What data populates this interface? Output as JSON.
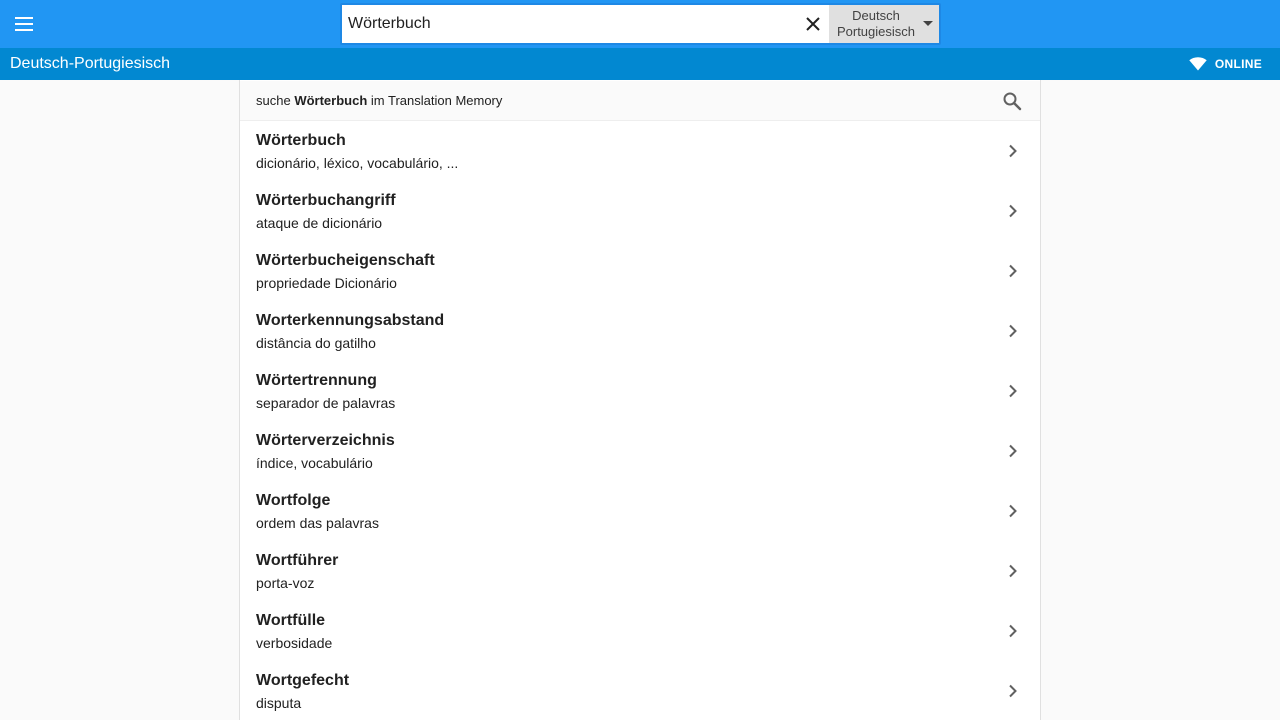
{
  "header": {
    "search_value": "Wörterbuch",
    "lang_source": "Deutsch",
    "lang_target": "Portugiesisch"
  },
  "subbar": {
    "title": "Deutsch-Portugiesisch",
    "status": "ONLINE"
  },
  "tm": {
    "prefix": "suche",
    "term": "Wörterbuch",
    "suffix": "im Translation Memory"
  },
  "results": [
    {
      "term": "Wörterbuch",
      "translation": "dicionário, léxico, vocabulário, ..."
    },
    {
      "term": "Wörterbuchangriff",
      "translation": "ataque de dicionário"
    },
    {
      "term": "Wörterbucheigenschaft",
      "translation": "propriedade Dicionário"
    },
    {
      "term": "Worterkennungsabstand",
      "translation": "distância do gatilho"
    },
    {
      "term": "Wörtertrennung",
      "translation": "separador de palavras"
    },
    {
      "term": "Wörterverzeichnis",
      "translation": "índice, vocabulário"
    },
    {
      "term": "Wortfolge",
      "translation": "ordem das palavras"
    },
    {
      "term": "Wortführer",
      "translation": "porta-voz"
    },
    {
      "term": "Wortfülle",
      "translation": "verbosidade"
    },
    {
      "term": "Wortgefecht",
      "translation": "disputa"
    }
  ],
  "icons": {
    "menu": "menu-icon",
    "clear": "close-icon",
    "dropdown": "caret-down-icon",
    "status": "wifi-icon",
    "search": "search-icon",
    "row": "chevron-right-icon"
  },
  "colors": {
    "topbar": "#2196f3",
    "subbar": "#0288d1",
    "search_border": "#1e88e5",
    "lang_select_bg": "#e0e0e0"
  }
}
